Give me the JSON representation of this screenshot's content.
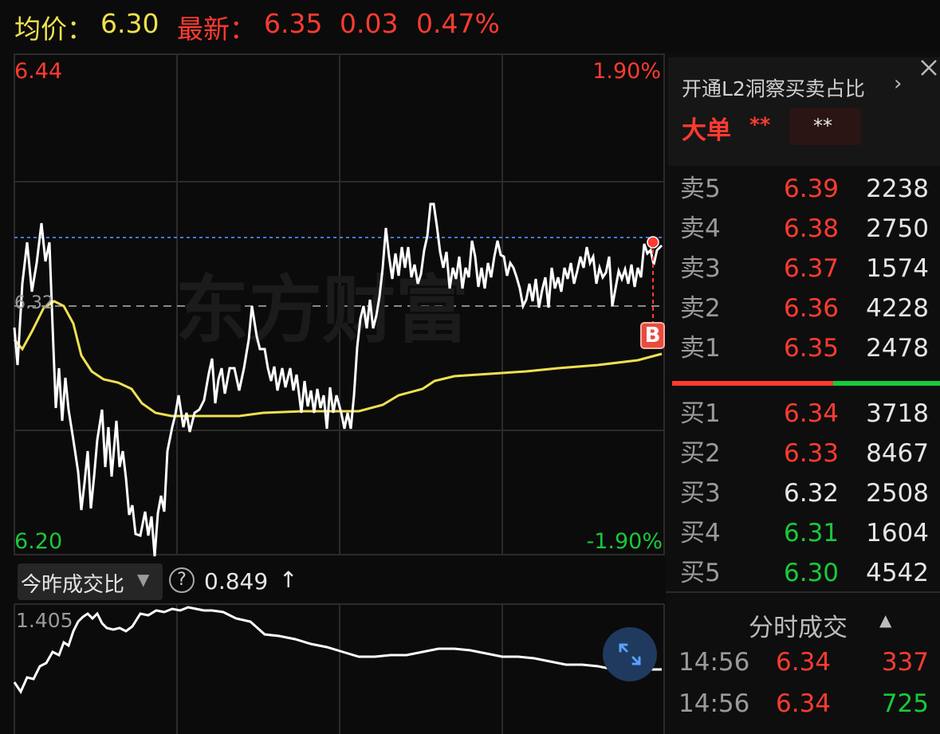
{
  "header": {
    "avg_label": "均价：",
    "avg_value": "6.30",
    "latest_label": "最新：",
    "latest_value": "6.35",
    "change": "0.03",
    "change_pct": "0.47%"
  },
  "chart": {
    "y_max": "6.44",
    "y_min": "6.20",
    "y_mid": "6.32",
    "pct_max": "1.90%",
    "pct_min": "-1.90%",
    "watermark": "东方财富",
    "marker": "B",
    "colors": {
      "price": "#ffffff",
      "avg": "#f0e050",
      "up": "#ff3b30",
      "down": "#19c93a",
      "ref": "#3b7ddd"
    }
  },
  "volume_panel": {
    "selector_label": "今昨成交比",
    "help_icon": "?",
    "ratio_value": "0.849",
    "trend_arrow": "↑",
    "scale_label": "1.405"
  },
  "l2": {
    "title": "开通L2洞察买卖占比",
    "big_order_label": "大单",
    "big_order_value": "**",
    "masked_value": "**"
  },
  "order_book": {
    "asks": [
      {
        "label": "卖5",
        "price": "6.39",
        "qty": "2238"
      },
      {
        "label": "卖4",
        "price": "6.38",
        "qty": "2750"
      },
      {
        "label": "卖3",
        "price": "6.37",
        "qty": "1574"
      },
      {
        "label": "卖2",
        "price": "6.36",
        "qty": "4228"
      },
      {
        "label": "卖1",
        "price": "6.35",
        "qty": "2478"
      }
    ],
    "bids": [
      {
        "label": "买1",
        "price": "6.34",
        "qty": "3718"
      },
      {
        "label": "买2",
        "price": "6.33",
        "qty": "8467"
      },
      {
        "label": "买3",
        "price": "6.32",
        "qty": "2508"
      },
      {
        "label": "买4",
        "price": "6.31",
        "qty": "1604"
      },
      {
        "label": "买5",
        "price": "6.30",
        "qty": "4542"
      }
    ]
  },
  "ticks": {
    "title": "分时成交",
    "rows": [
      {
        "time": "14:56",
        "price": "6.34",
        "vol": "337"
      },
      {
        "time": "14:56",
        "price": "6.34",
        "vol": "725"
      }
    ]
  }
}
